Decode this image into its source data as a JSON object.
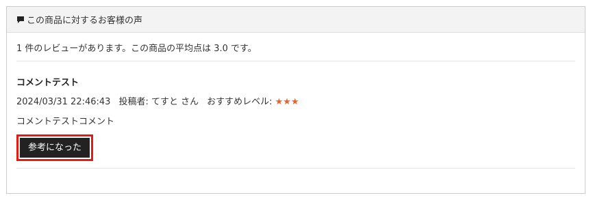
{
  "panel": {
    "header_icon": "comment-icon",
    "title": "この商品に対するお客様の声"
  },
  "summary": {
    "text": "1 件のレビューがあります。この商品の平均点は 3.0 です。"
  },
  "review": {
    "title": "コメントテスト",
    "date": "2024/03/31 22:46:43",
    "poster_label": "投稿者: てすと さん",
    "recommend_label": "おすすめレベル:",
    "stars_text": "★★★",
    "rating": 3,
    "body": "コメントテストコメント",
    "helpful_button_label": "参考になった"
  },
  "colors": {
    "star": "#e8632a",
    "button_bg": "#222222",
    "highlight_border": "#e8190f",
    "header_bg": "#f3f3f3"
  }
}
